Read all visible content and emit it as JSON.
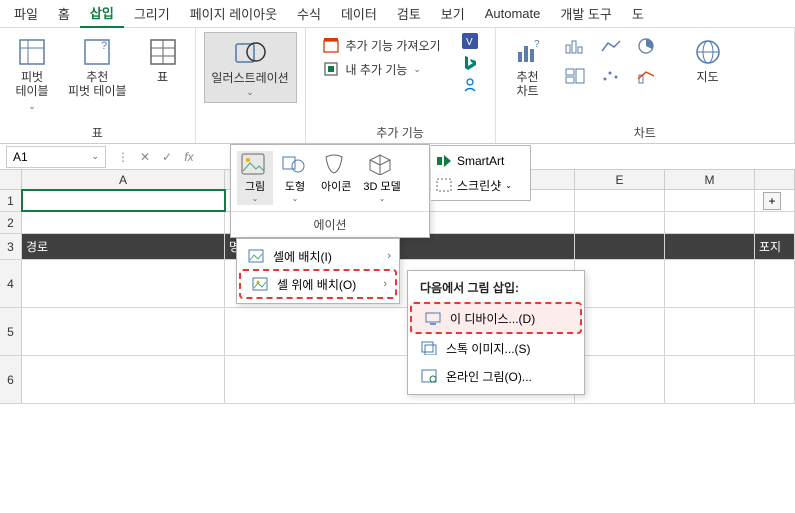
{
  "menubar": [
    "파일",
    "홈",
    "삽입",
    "그리기",
    "페이지 레이아웃",
    "수식",
    "데이터",
    "검토",
    "보기",
    "Automate",
    "개발 도구",
    "도"
  ],
  "active_tab_index": 2,
  "ribbon": {
    "tables": {
      "pivot": "피벗\n테이블",
      "recommended": "추천\n피벗 테이블",
      "table": "표",
      "group_label": "표"
    },
    "illustrations": {
      "button": "일러스트레이션",
      "group_label": ""
    },
    "addins": {
      "get": "추가 기능 가져오기",
      "my": "내 추가 기능",
      "group_label": "추가 기능"
    },
    "charts": {
      "recommended": "추천\n차트",
      "group_label": "차트",
      "map": "지도"
    }
  },
  "namebox": "A1",
  "sheet_cols": {
    "gap": "",
    "A": "A",
    "E": "E",
    "M": "M"
  },
  "rows": [
    "1",
    "2",
    "3",
    "4",
    "5",
    "6"
  ],
  "dark_headers": {
    "path": "경로",
    "list": "명단",
    "pos": "포지"
  },
  "illus_panel": {
    "picture": "그림",
    "shapes": "도형",
    "icons": "아이콘",
    "model3d": "3D\n모델",
    "smartart": "SmartArt",
    "screenshot": "스크린샷",
    "footer": "에이션"
  },
  "pic_menu": {
    "in_cell": "셀에 배치(I)",
    "over_cell": "셀 위에 배치(O)"
  },
  "insert_from": {
    "title": "다음에서 그림 삽입:",
    "device": "이 디바이스...(D)",
    "stock": "스톡 이미지...(S)",
    "online": "온라인 그림(O)..."
  }
}
